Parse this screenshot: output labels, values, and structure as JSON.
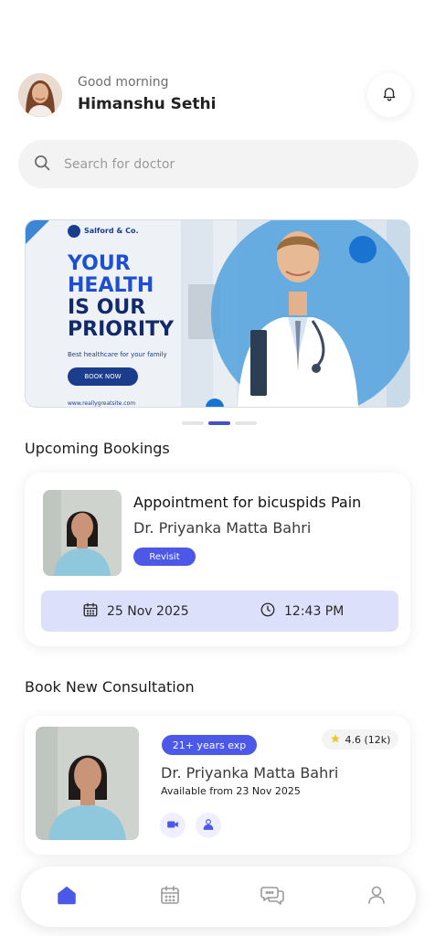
{
  "header": {
    "greeting": "Good morning",
    "user_name": "Himanshu Sethi"
  },
  "search": {
    "placeholder": "Search for doctor"
  },
  "banner": {
    "brand": "Salford & Co.",
    "headline": [
      "YOUR",
      "HEALTH",
      "IS OUR",
      "PRIORITY"
    ],
    "subtitle": "Best healthcare for your family",
    "button_label": "BOOK NOW",
    "url": "www.reallygreatsite.com",
    "active_slide": 2,
    "slide_count": 3
  },
  "upcoming": {
    "section_title": "Upcoming Bookings",
    "title": "Appointment for bicuspids Pain",
    "doctor": "Dr. Priyanka Matta Bahri",
    "badge": "Revisit",
    "date": "25 Nov 2025",
    "time": "12:43 PM"
  },
  "consultation": {
    "section_title": "Book New Consultation",
    "experience": "21+ years exp",
    "rating": "4.6 (12k)",
    "doctor": "Dr. Priyanka Matta Bahri",
    "availability": "Available from 23 Nov 2025",
    "action_icons": [
      "video-call-icon",
      "doctor-profile-icon"
    ]
  },
  "bottom_nav": {
    "items": [
      "home-icon",
      "calendar-icon",
      "chat-icon",
      "profile-icon"
    ],
    "active": "home-icon"
  },
  "colors": {
    "accent": "#4c58e8",
    "accent_dark": "#4353c4",
    "date_bar": "#dde0fb",
    "banner_blue": "#1e4fd0",
    "banner_navy": "#1b3d8c",
    "star": "#e7c92a"
  }
}
